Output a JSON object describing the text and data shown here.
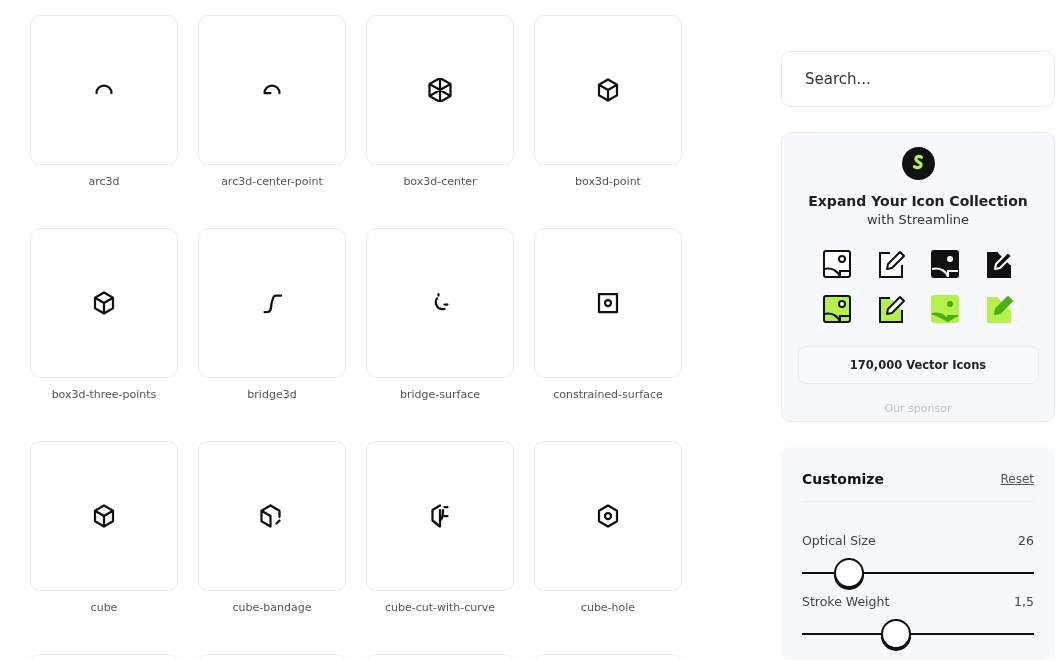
{
  "icons": [
    {
      "kind": "icon",
      "label": "arc3d"
    },
    {
      "kind": "icon",
      "label": "arc3d-center-point"
    },
    {
      "kind": "icon",
      "label": "box3d-center"
    },
    {
      "kind": "icon",
      "label": "box3d-point"
    },
    {
      "kind": "icon",
      "label": "box3d-three-points"
    },
    {
      "kind": "icon",
      "label": "bridge3d"
    },
    {
      "kind": "icon",
      "label": "bridge-surface"
    },
    {
      "kind": "icon",
      "label": "constrained-surface"
    },
    {
      "kind": "icon",
      "label": "cube"
    },
    {
      "kind": "icon",
      "label": "cube-bandage"
    },
    {
      "kind": "icon",
      "label": "cube-cut-with-curve"
    },
    {
      "kind": "icon",
      "label": "cube-hole"
    },
    {
      "kind": "cut-off"
    },
    {
      "kind": "cut-off"
    },
    {
      "kind": "cut-off"
    },
    {
      "kind": "cut-off"
    }
  ],
  "search": {
    "placeholder": "Search..."
  },
  "sponsor": {
    "title": "Expand Your Icon Collection",
    "subtitle": "with Streamline",
    "button": "170,000 Vector Icons",
    "footer": "Our sponsor"
  },
  "customize": {
    "title": "Customize",
    "reset": "Reset",
    "sliders": [
      {
        "label": "Optical Size",
        "reading": "26",
        "level": 0.2
      },
      {
        "label": "Stroke Weight",
        "reading": "1,5",
        "level": 0.4
      }
    ]
  }
}
